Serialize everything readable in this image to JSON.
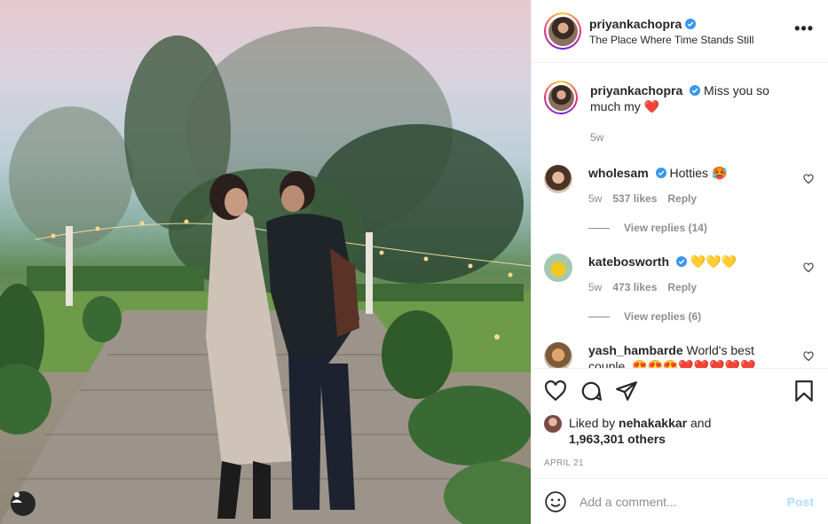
{
  "post": {
    "author": "priyankachopra",
    "location": "The Place Where Time Stands Still",
    "more_icon": "more-options-icon",
    "photo_alt": "Couple standing in a garden at dusk"
  },
  "caption": {
    "author": "priyankachopra",
    "text": "Miss you so much my ❤️",
    "age": "5w"
  },
  "comments": [
    {
      "author": "wholesam",
      "text": "Hotties 🥵",
      "age": "5w",
      "likes": "537 likes",
      "reply": "Reply",
      "view_replies": "View replies (14)"
    },
    {
      "author": "katebosworth",
      "text": "💛💛💛",
      "age": "5w",
      "likes": "473 likes",
      "reply": "Reply",
      "view_replies": "View replies (6)"
    },
    {
      "author": "yash_hambarde",
      "text": "World's best couple..😍😍😍❤️❤️❤️❤️❤️"
    }
  ],
  "likes": {
    "prefix": "Liked by",
    "user": "nehakakkar",
    "and": "and",
    "count": "1,963,301 others"
  },
  "date": "April 21",
  "add_comment": {
    "placeholder": "Add a comment...",
    "post_label": "Post"
  },
  "colors": {
    "verified": "#3897f0",
    "link_blue": "#b2dffc",
    "muted": "#8e8e8e",
    "heart": "#ed4956"
  }
}
